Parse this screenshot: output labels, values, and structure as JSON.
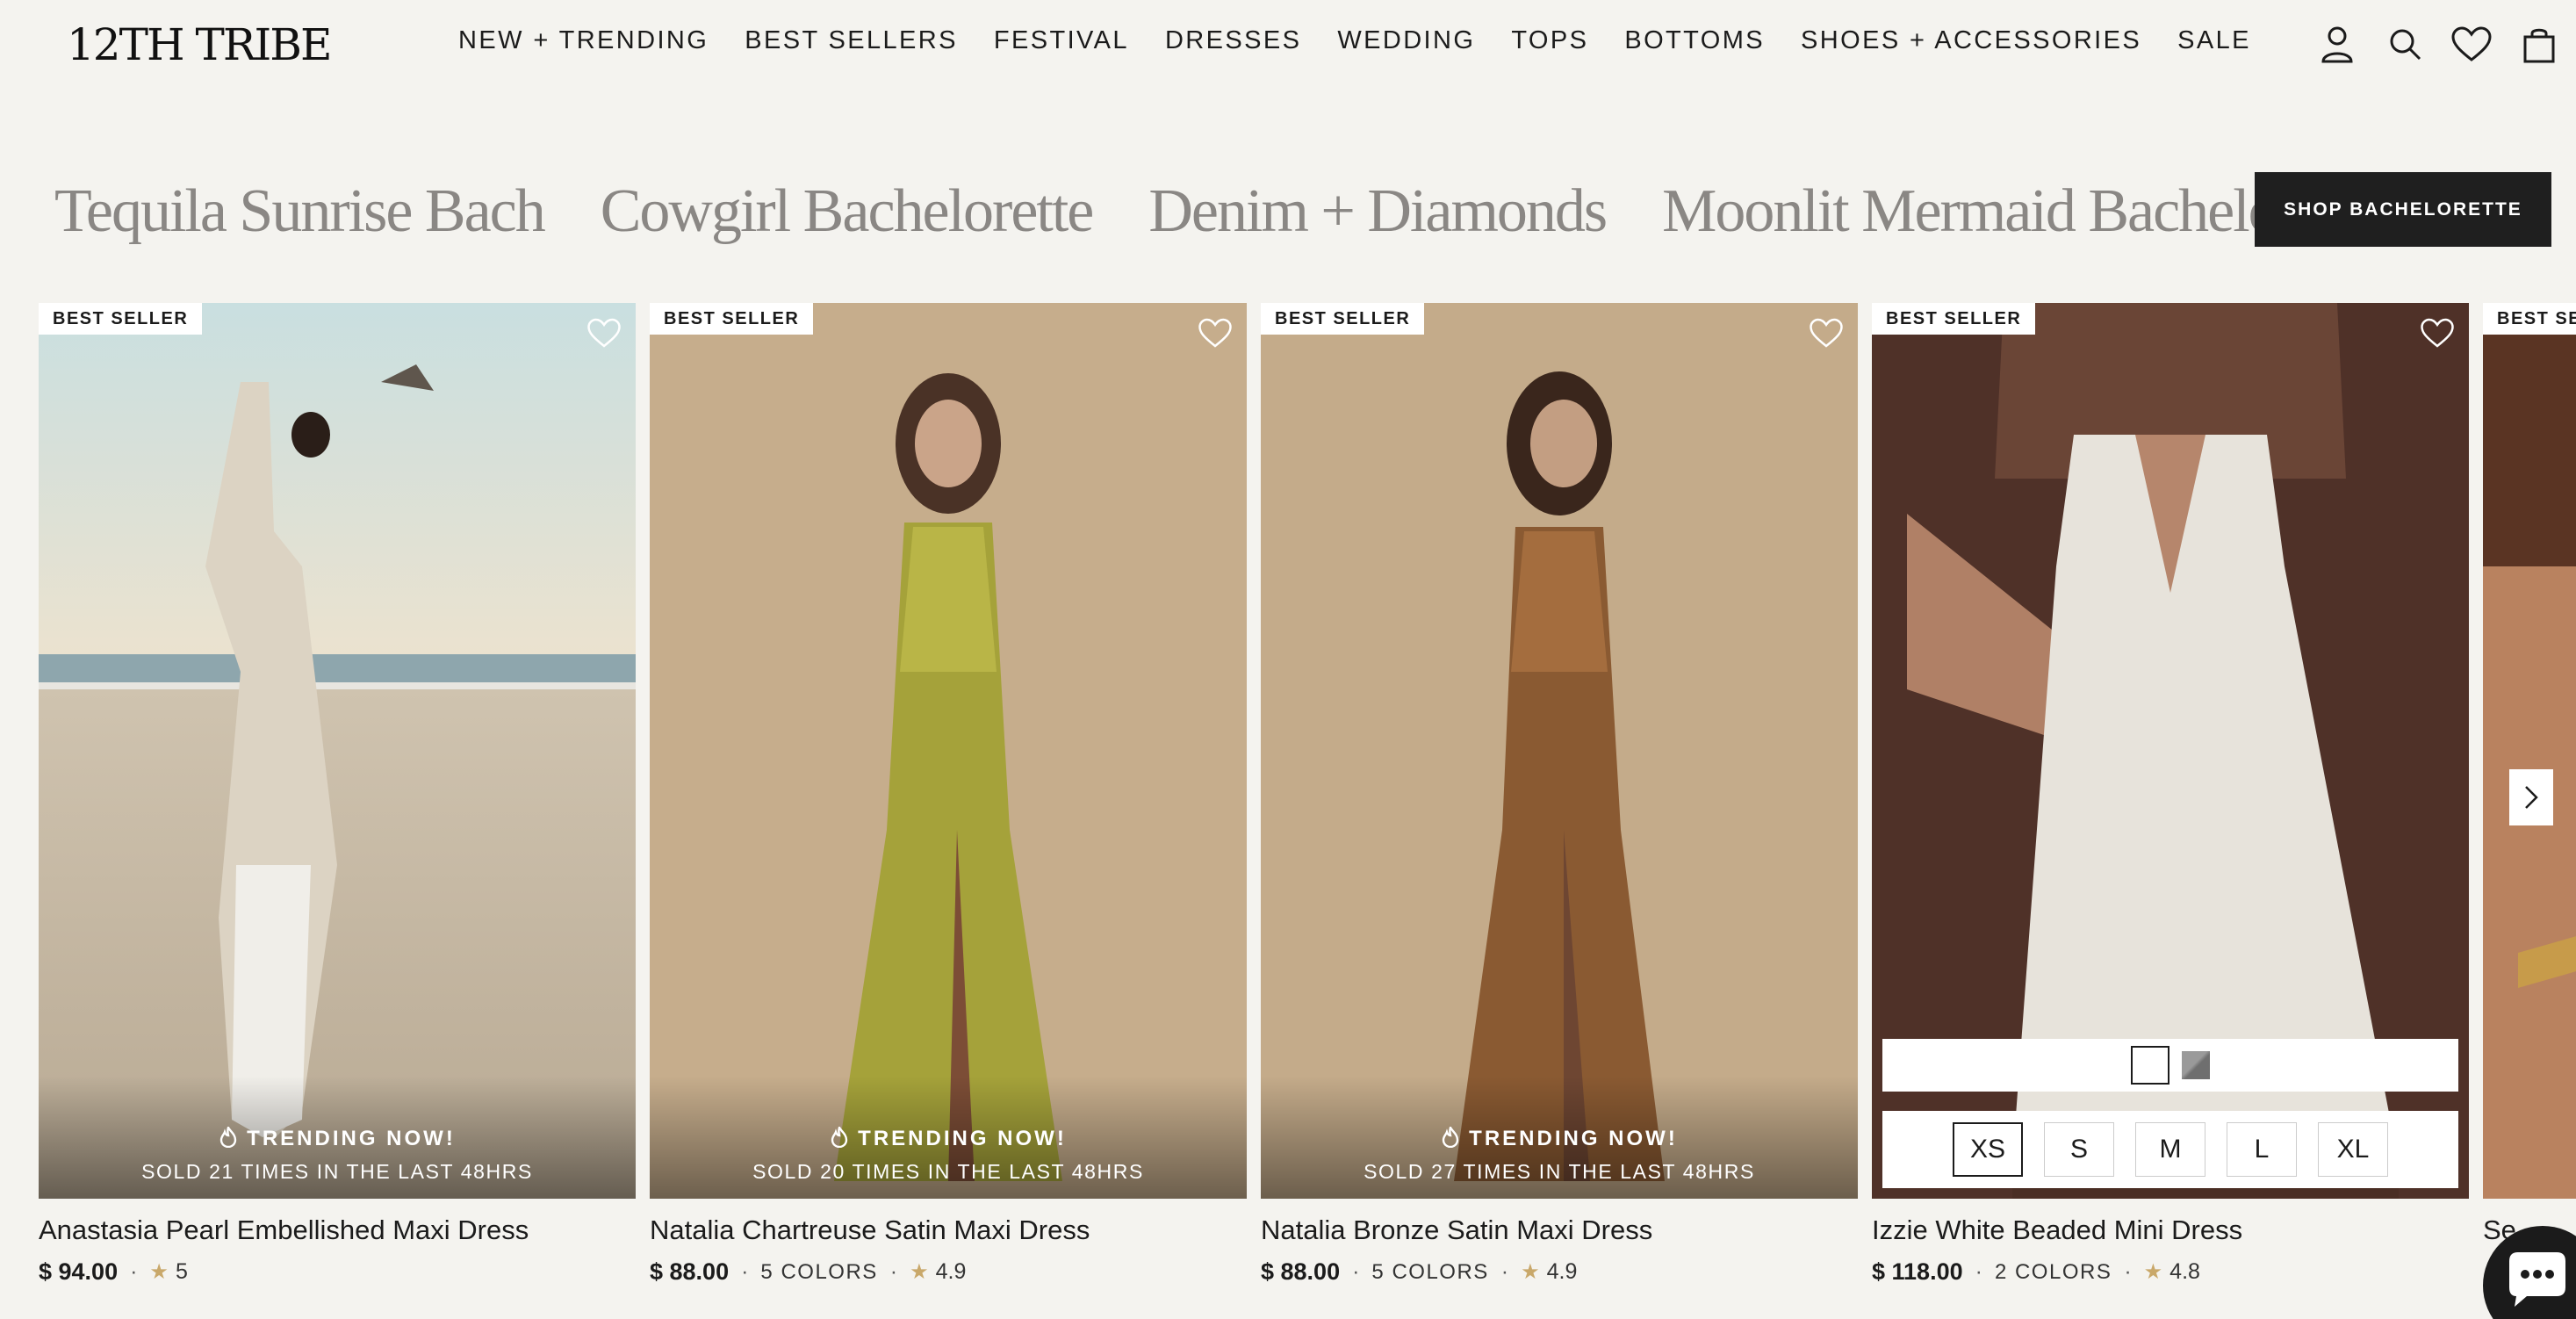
{
  "brand": {
    "logo_text": "12TH TRIBE"
  },
  "nav": {
    "items": [
      "NEW + TRENDING",
      "BEST SELLERS",
      "FESTIVAL",
      "DRESSES",
      "WEDDING",
      "TOPS",
      "BOTTOMS",
      "SHOES + ACCESSORIES",
      "SALE"
    ]
  },
  "header_icons": [
    "account-icon",
    "search-icon",
    "wishlist-icon",
    "bag-icon"
  ],
  "collections": {
    "items": [
      "Tequila Sunrise Bach",
      "Cowgirl Bachelorette",
      "Denim + Diamonds",
      "Moonlit Mermaid Bachelorette"
    ],
    "button_label": "SHOP BACHELORETTE"
  },
  "products": [
    {
      "badge": "BEST SELLER",
      "name": "Anastasia Pearl Embellished Maxi Dress",
      "price": "$ 94.00",
      "colors": "",
      "rating": "5",
      "trending_label": "TRENDING NOW!",
      "trending_sold": "SOLD 21 TIMES IN THE LAST 48HRS"
    },
    {
      "badge": "BEST SELLER",
      "name": "Natalia Chartreuse Satin Maxi Dress",
      "price": "$ 88.00",
      "colors": "5 COLORS",
      "rating": "4.9",
      "trending_label": "TRENDING NOW!",
      "trending_sold": "SOLD 20 TIMES IN THE LAST 48HRS"
    },
    {
      "badge": "BEST SELLER",
      "name": "Natalia Bronze Satin Maxi Dress",
      "price": "$ 88.00",
      "colors": "5 COLORS",
      "rating": "4.9",
      "trending_label": "TRENDING NOW!",
      "trending_sold": "SOLD 27 TIMES IN THE LAST 48HRS"
    },
    {
      "badge": "BEST SELLER",
      "name": "Izzie White Beaded Mini Dress",
      "price": "$ 118.00",
      "colors": "2 COLORS",
      "rating": "4.8",
      "sizes": [
        "XS",
        "S",
        "M",
        "L",
        "XL"
      ],
      "selected_size": "XS"
    },
    {
      "badge": "BEST SE",
      "name": "Se"
    }
  ],
  "colors": {
    "background": "#f4f3ef",
    "button": "#1f1f1f",
    "star": "#c9a86a"
  }
}
